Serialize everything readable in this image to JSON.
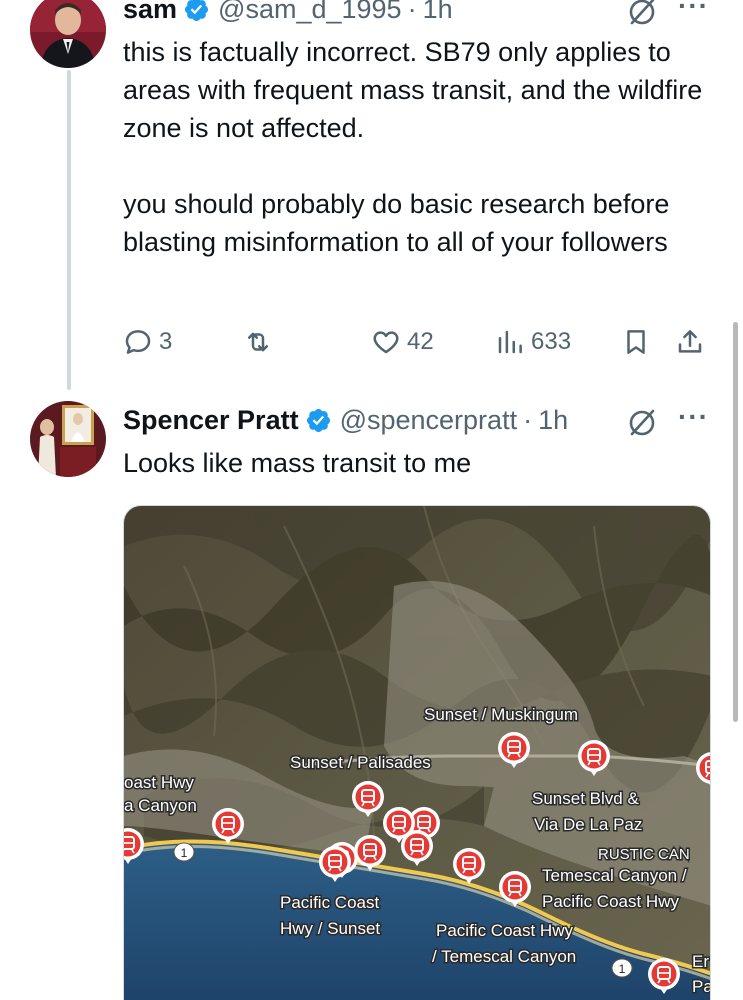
{
  "tweets": [
    {
      "name": "sam",
      "handle": "@sam_d_1995",
      "separator": "·",
      "time": "1h",
      "paragraphs": [
        "this is factually incorrect. SB79 only applies to areas with frequent mass transit, and the wildfire zone is not affected.",
        "you should probably do basic research before blasting misinformation to all of your followers"
      ],
      "stats": {
        "replies": "3",
        "reposts": "",
        "likes": "42",
        "views": "633"
      }
    },
    {
      "name": "Spencer Pratt",
      "handle": "@spencerpratt",
      "separator": "·",
      "time": "1h",
      "paragraphs": [
        "Looks like mass transit to me"
      ],
      "media": {
        "labels": {
          "sunset_muskingum": "Sunset / Muskingum",
          "sunset_palisades": "Sunset / Palisades",
          "coast_hwy": "oast Hwy",
          "canyon": "a Canyon",
          "sunset_blvd_1": "Sunset Blvd &",
          "sunset_blvd_2": "Via De La Paz",
          "rustic_can": "RUSTIC CAN",
          "temescal_1": "Temescal Canyon /",
          "temescal_2": "Pacific Coast Hwy",
          "pch_sunset_1": "Pacific Coast",
          "pch_sunset_2": "Hwy / Sunset",
          "pch_temescal_1": "Pacific Coast Hwy",
          "pch_temescal_2": "/ Temescal Canyon",
          "er": "Er",
          "pa": "Pa",
          "route_shield": "1"
        }
      }
    }
  ],
  "icons": {
    "verified": "verified-badge-icon",
    "grok": "grok-icon",
    "more": "more-icon",
    "reply": "reply-icon",
    "repost": "repost-icon",
    "like": "heart-icon",
    "views": "views-icon",
    "bookmark": "bookmark-icon",
    "share": "share-icon",
    "transit_pin": "transit-pin-icon"
  },
  "colors": {
    "verified": "#1d9bf0",
    "secondary_text": "#536471",
    "transit_pin": "#e53935"
  }
}
